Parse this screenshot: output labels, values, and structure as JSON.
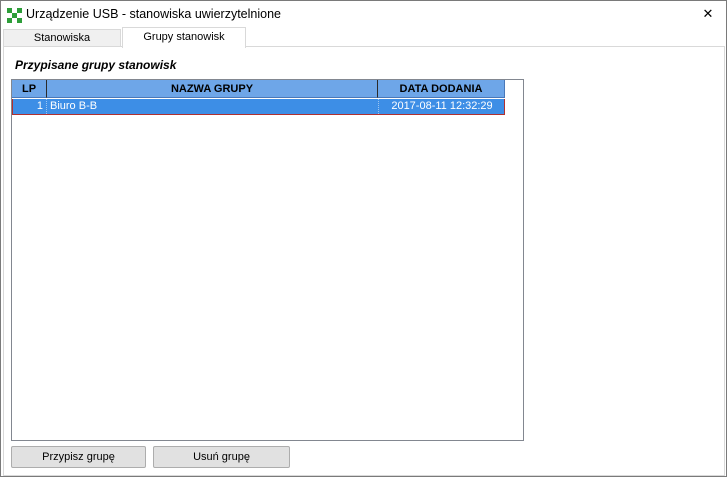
{
  "window": {
    "title": "Urządzenie USB - stanowiska uwierzytelnione",
    "close_label": "✕"
  },
  "tabs": [
    {
      "label": "Stanowiska",
      "active": false
    },
    {
      "label": "Grupy stanowisk",
      "active": true
    }
  ],
  "panel": {
    "section_title": "Przypisane grupy stanowisk"
  },
  "grid": {
    "columns": [
      "LP",
      "NAZWA GRUPY",
      "DATA DODANIA"
    ],
    "rows": [
      {
        "lp": "1",
        "name": "Biuro B-B",
        "date": "2017-08-11 12:32:29",
        "selected": true
      }
    ]
  },
  "buttons": {
    "assign_label": "Przypisz grupę",
    "remove_label": "Usuń grupę"
  },
  "colors": {
    "header_bg": "#6ea6e8",
    "selection_bg": "#3d8ee6",
    "button_bg": "#e1e1e1"
  },
  "icons": {
    "app": "checkered-app-icon",
    "close": "close-icon"
  }
}
